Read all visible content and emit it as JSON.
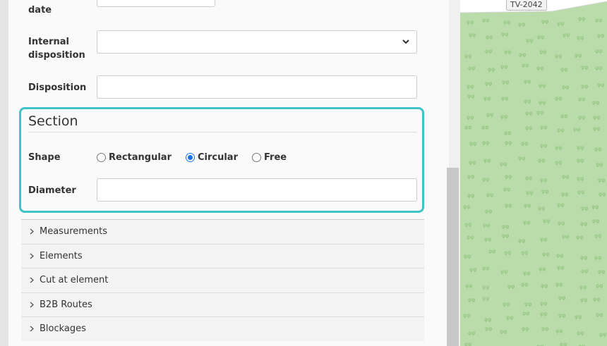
{
  "form": {
    "date_label": "date",
    "internal_disposition_label": "Internal disposition",
    "disposition_label": "Disposition"
  },
  "section": {
    "title": "Section",
    "shape_label": "Shape",
    "shape_options": [
      "Rectangular",
      "Circular",
      "Free"
    ],
    "shape_selected": "Circular",
    "diameter_label": "Diameter"
  },
  "accordion": {
    "items": [
      "Measurements",
      "Elements",
      "Cut at element",
      "B2B Routes",
      "Blockages"
    ]
  },
  "map": {
    "road_label": "TV-2042"
  }
}
